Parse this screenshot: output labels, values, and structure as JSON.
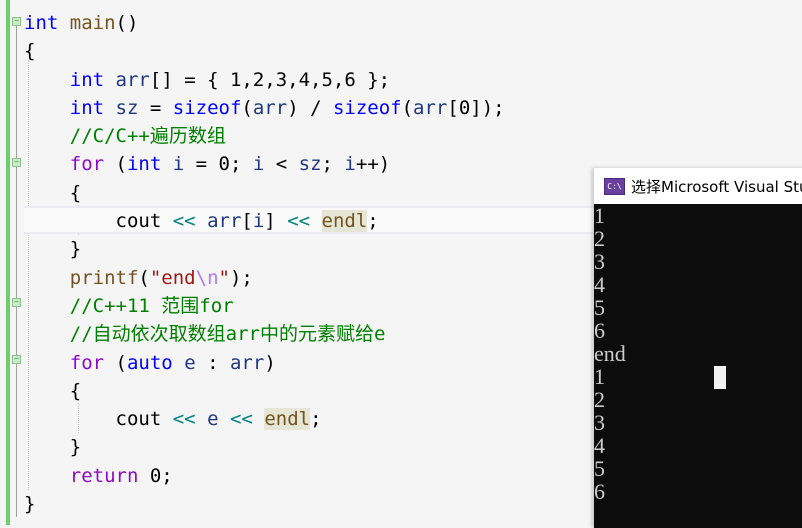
{
  "editor": {
    "lines": [
      [
        {
          "t": "int",
          "c": "kw"
        },
        {
          "t": " ",
          "c": ""
        },
        {
          "t": "main",
          "c": "fn"
        },
        {
          "t": "()",
          "c": ""
        }
      ],
      [
        {
          "t": "{",
          "c": ""
        }
      ],
      [
        {
          "t": "    ",
          "c": ""
        },
        {
          "t": "int",
          "c": "kw"
        },
        {
          "t": " ",
          "c": ""
        },
        {
          "t": "arr",
          "c": "var"
        },
        {
          "t": "[] = { 1,2,3,4,5,6 };",
          "c": ""
        }
      ],
      [
        {
          "t": "    ",
          "c": ""
        },
        {
          "t": "int",
          "c": "kw"
        },
        {
          "t": " ",
          "c": ""
        },
        {
          "t": "sz",
          "c": "var"
        },
        {
          "t": " = ",
          "c": ""
        },
        {
          "t": "sizeof",
          "c": "kw"
        },
        {
          "t": "(",
          "c": ""
        },
        {
          "t": "arr",
          "c": "var"
        },
        {
          "t": ") / ",
          "c": ""
        },
        {
          "t": "sizeof",
          "c": "kw"
        },
        {
          "t": "(",
          "c": ""
        },
        {
          "t": "arr",
          "c": "var"
        },
        {
          "t": "[0]);",
          "c": ""
        }
      ],
      [
        {
          "t": "    ",
          "c": ""
        },
        {
          "t": "//C/C++遍历数组",
          "c": "cm"
        }
      ],
      [
        {
          "t": "    ",
          "c": ""
        },
        {
          "t": "for",
          "c": "ctl"
        },
        {
          "t": " (",
          "c": ""
        },
        {
          "t": "int",
          "c": "kw"
        },
        {
          "t": " ",
          "c": ""
        },
        {
          "t": "i",
          "c": "var"
        },
        {
          "t": " = 0; ",
          "c": ""
        },
        {
          "t": "i",
          "c": "var"
        },
        {
          "t": " < ",
          "c": ""
        },
        {
          "t": "sz",
          "c": "var"
        },
        {
          "t": "; ",
          "c": ""
        },
        {
          "t": "i",
          "c": "var"
        },
        {
          "t": "++)",
          "c": ""
        }
      ],
      [
        {
          "t": "    {",
          "c": ""
        }
      ],
      [
        {
          "t": "        cout ",
          "c": ""
        },
        {
          "t": "<<",
          "c": "op"
        },
        {
          "t": " ",
          "c": ""
        },
        {
          "t": "arr",
          "c": "var"
        },
        {
          "t": "[",
          "c": ""
        },
        {
          "t": "i",
          "c": "var"
        },
        {
          "t": "] ",
          "c": ""
        },
        {
          "t": "<<",
          "c": "op"
        },
        {
          "t": " ",
          "c": ""
        },
        {
          "t": "endl",
          "c": "endl"
        },
        {
          "t": ";",
          "c": ""
        }
      ],
      [
        {
          "t": "    }",
          "c": ""
        }
      ],
      [
        {
          "t": "    ",
          "c": ""
        },
        {
          "t": "printf",
          "c": "fn"
        },
        {
          "t": "(",
          "c": ""
        },
        {
          "t": "\"end",
          "c": "str"
        },
        {
          "t": "\\n",
          "c": "esc"
        },
        {
          "t": "\"",
          "c": "str"
        },
        {
          "t": ");",
          "c": ""
        }
      ],
      [
        {
          "t": "    ",
          "c": ""
        },
        {
          "t": "//C++11 范围for",
          "c": "cm"
        }
      ],
      [
        {
          "t": "    ",
          "c": ""
        },
        {
          "t": "//自动依次取数组arr中的元素赋给e",
          "c": "cm"
        }
      ],
      [
        {
          "t": "    ",
          "c": ""
        },
        {
          "t": "for",
          "c": "ctl"
        },
        {
          "t": " (",
          "c": ""
        },
        {
          "t": "auto",
          "c": "kw"
        },
        {
          "t": " ",
          "c": ""
        },
        {
          "t": "e",
          "c": "var"
        },
        {
          "t": " : ",
          "c": ""
        },
        {
          "t": "arr",
          "c": "var"
        },
        {
          "t": ")",
          "c": ""
        }
      ],
      [
        {
          "t": "    {",
          "c": ""
        }
      ],
      [
        {
          "t": "        cout ",
          "c": ""
        },
        {
          "t": "<<",
          "c": "op"
        },
        {
          "t": " ",
          "c": ""
        },
        {
          "t": "e",
          "c": "var"
        },
        {
          "t": " ",
          "c": ""
        },
        {
          "t": "<<",
          "c": "op"
        },
        {
          "t": " ",
          "c": ""
        },
        {
          "t": "endl",
          "c": "endl"
        },
        {
          "t": ";",
          "c": ""
        }
      ],
      [
        {
          "t": "    }",
          "c": ""
        }
      ],
      [
        {
          "t": "    ",
          "c": ""
        },
        {
          "t": "return",
          "c": "ctl"
        },
        {
          "t": " 0;",
          "c": ""
        }
      ],
      [
        {
          "t": "}",
          "c": ""
        }
      ]
    ]
  },
  "console": {
    "title": "选择Microsoft Visual Stu",
    "icon": "console-app-icon",
    "icon_text": "C:\\",
    "output": [
      "1",
      "2",
      "3",
      "4",
      "5",
      "6",
      "end",
      "1",
      "2",
      "3",
      "4",
      "5",
      "6"
    ]
  }
}
